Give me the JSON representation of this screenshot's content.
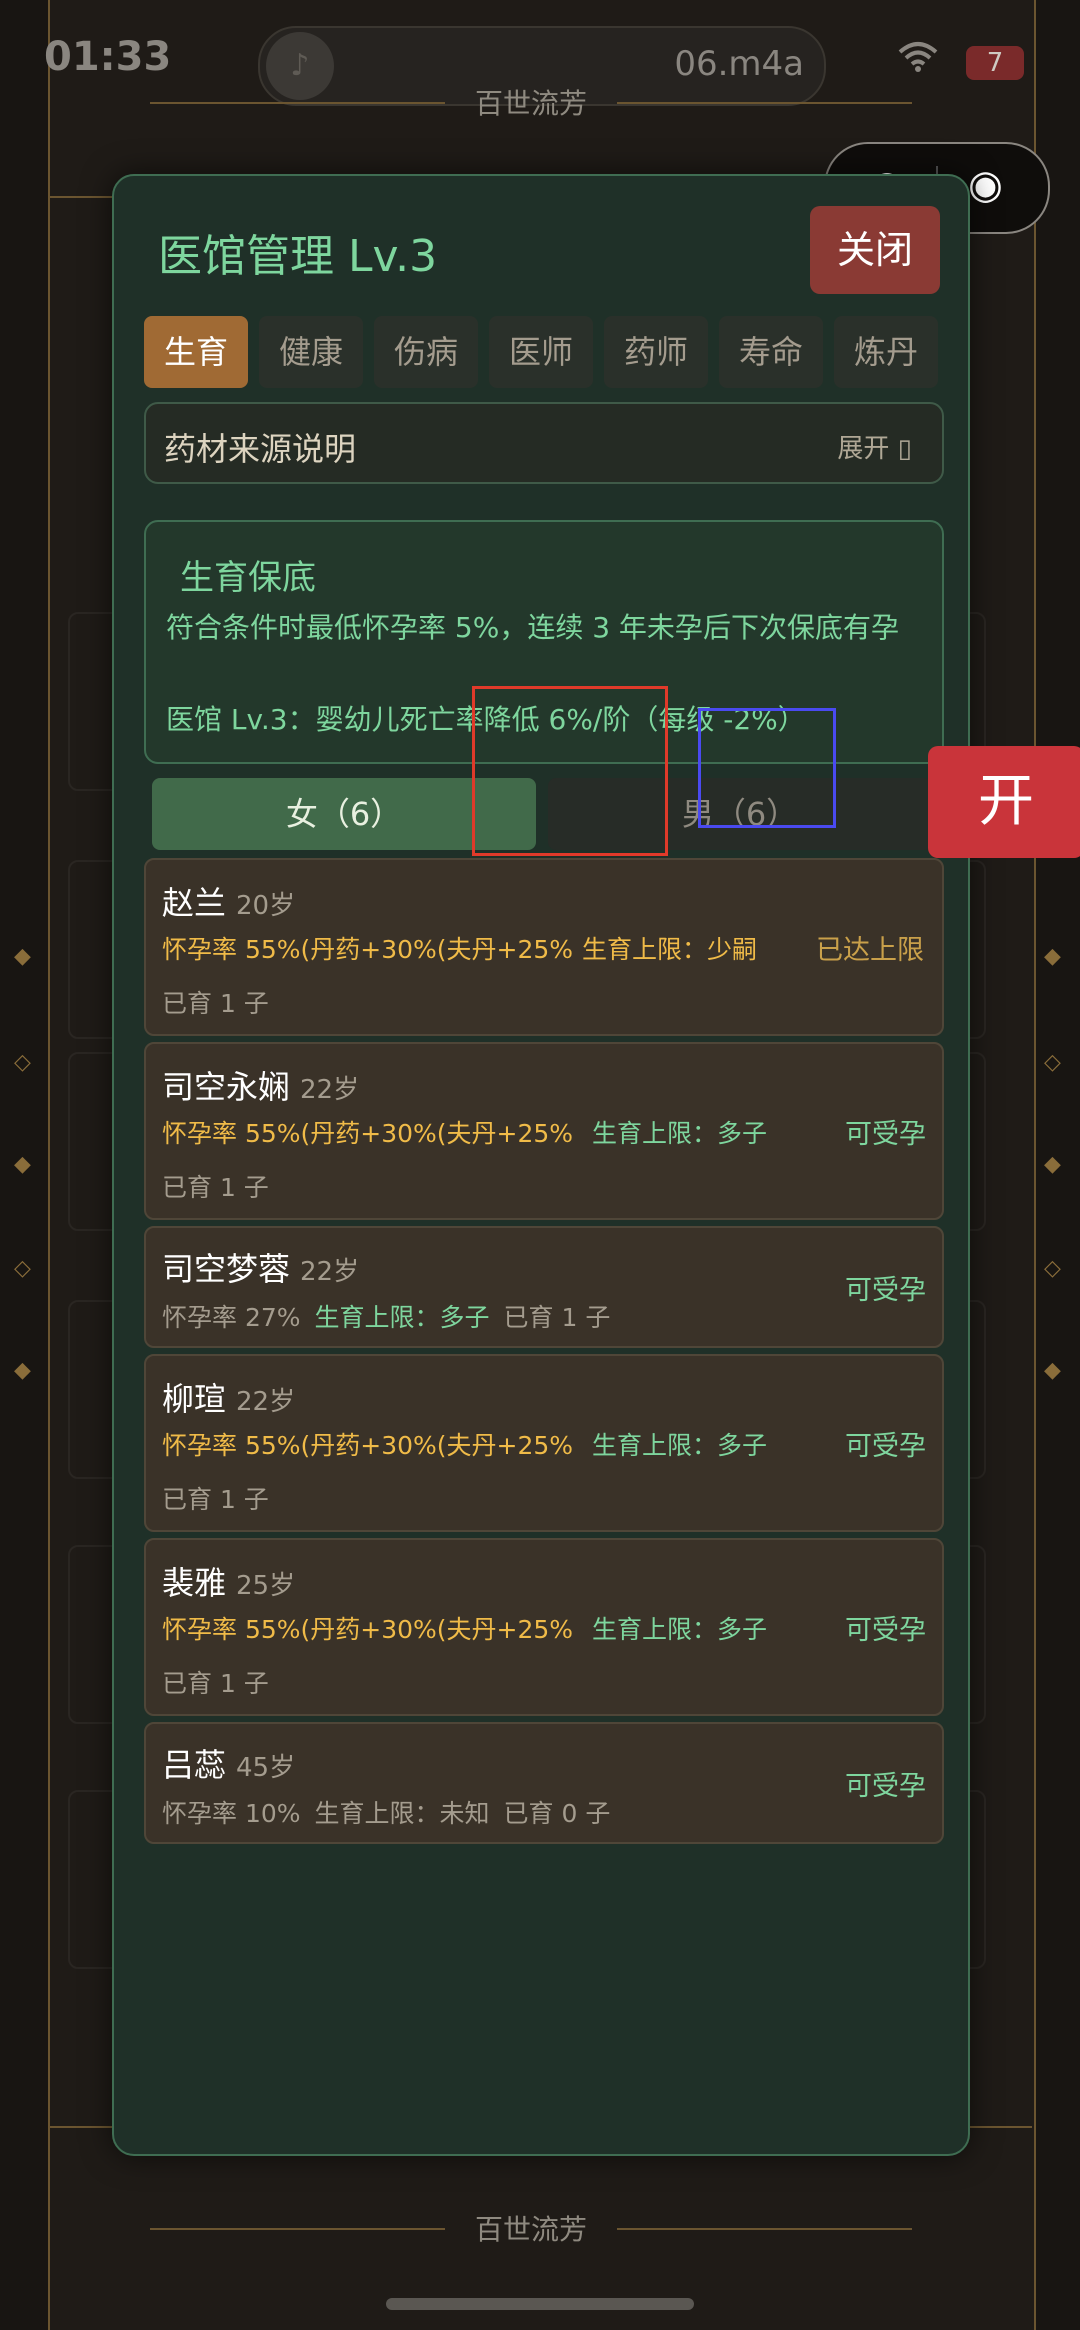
{
  "status_bar": {
    "time": "01:33",
    "music_file": "06.m4a",
    "battery": "7"
  },
  "game": {
    "title": "百世流芳",
    "footer": "百世流芳"
  },
  "capsule": {
    "more_icon": "more-dots-icon",
    "target_icon": "target-icon"
  },
  "modal": {
    "title": "医馆管理 Lv.3",
    "close_label": "关闭",
    "tabs": [
      "生育",
      "健康",
      "伤病",
      "医师",
      "药师",
      "寿命",
      "炼丹"
    ],
    "active_tab": "生育",
    "source": {
      "label": "药材来源说明",
      "expand": "展开 ▯"
    },
    "guarantee": {
      "title": "生育保底",
      "line1": "符合条件时最低怀孕率 5%，连续 3 年未孕后下次保底有孕",
      "line2": "医馆 Lv.3：婴幼儿死亡率降低 6%/阶（每级 -2%）"
    },
    "gender_tabs": {
      "female": "女（6）",
      "male": "男（6）"
    },
    "people": [
      {
        "name": "赵兰",
        "age": "20岁",
        "rate": "怀孕率 55%(丹药+30%(夫丹+25%",
        "limit": "生育上限：少嗣",
        "born": "已育 1 子",
        "status": "已达上限"
      },
      {
        "name": "司空永娴",
        "age": "22岁",
        "rate": "怀孕率 55%(丹药+30%(夫丹+25%",
        "limit": "生育上限：多子",
        "born": "已育 1 子",
        "status": "可受孕"
      },
      {
        "name": "司空梦蓉",
        "age": "22岁",
        "rate": "怀孕率 27%",
        "limit": "生育上限：多子",
        "born": "已育 1 子",
        "status": "可受孕"
      },
      {
        "name": "柳瑄",
        "age": "22岁",
        "rate": "怀孕率 55%(丹药+30%(夫丹+25%",
        "limit": "生育上限：多子",
        "born": "已育 1 子",
        "status": "可受孕"
      },
      {
        "name": "裴雅",
        "age": "25岁",
        "rate": "怀孕率 55%(丹药+30%(夫丹+25%",
        "limit": "生育上限：多子",
        "born": "已育 1 子",
        "status": "可受孕"
      },
      {
        "name": "吕蕊",
        "age": "45岁",
        "rate": "怀孕率 10%",
        "limit": "生育上限：未知",
        "born": "已育 0 子",
        "status": "可受孕"
      }
    ]
  },
  "open_button": "开",
  "colors": {
    "accent_green": "#7ed69e",
    "accent_gold": "#f0bb48",
    "close_red": "#8a3a34",
    "open_red": "#c9343a",
    "tab_active": "#a06a34"
  }
}
